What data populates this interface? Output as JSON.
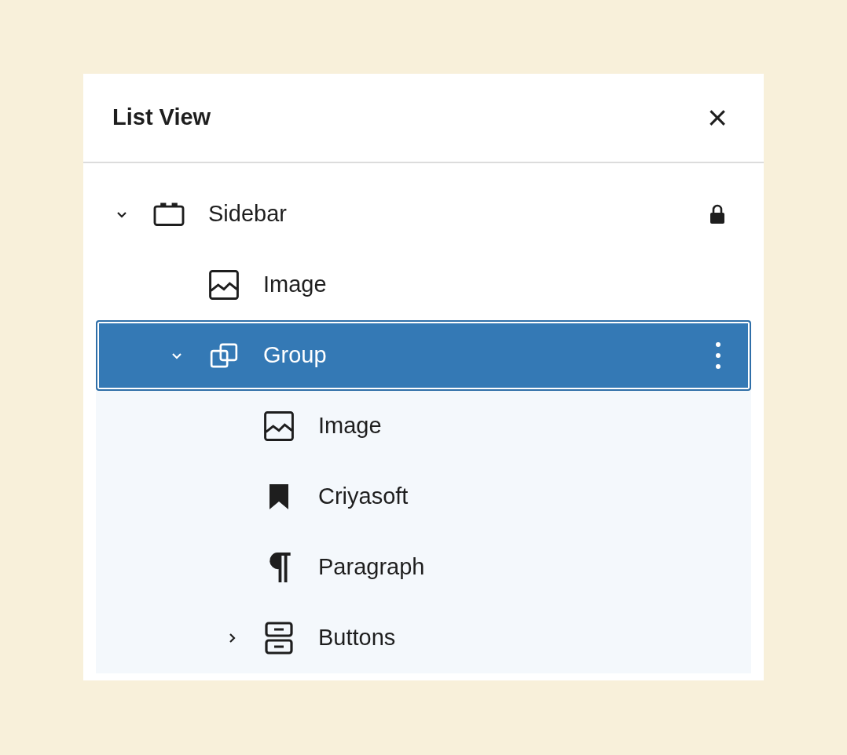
{
  "panel": {
    "title": "List View",
    "close_label": "×"
  },
  "tree": [
    {
      "label": "Sidebar",
      "kind": "sidebar",
      "selected": false,
      "expanded": true,
      "locked": true,
      "children": [
        {
          "label": "Image",
          "kind": "image",
          "selected": false,
          "locked": false
        },
        {
          "label": "Group",
          "kind": "group",
          "selected": true,
          "expanded": true,
          "locked": false,
          "children": [
            {
              "label": "Image",
              "kind": "image",
              "selected": false,
              "locked": false
            },
            {
              "label": "Criyasoft",
              "kind": "bookmark",
              "selected": false,
              "locked": false
            },
            {
              "label": "Paragraph",
              "kind": "paragraph",
              "selected": false,
              "locked": false
            },
            {
              "label": "Buttons",
              "kind": "buttons",
              "selected": false,
              "expanded": false,
              "locked": false
            }
          ]
        }
      ]
    }
  ]
}
